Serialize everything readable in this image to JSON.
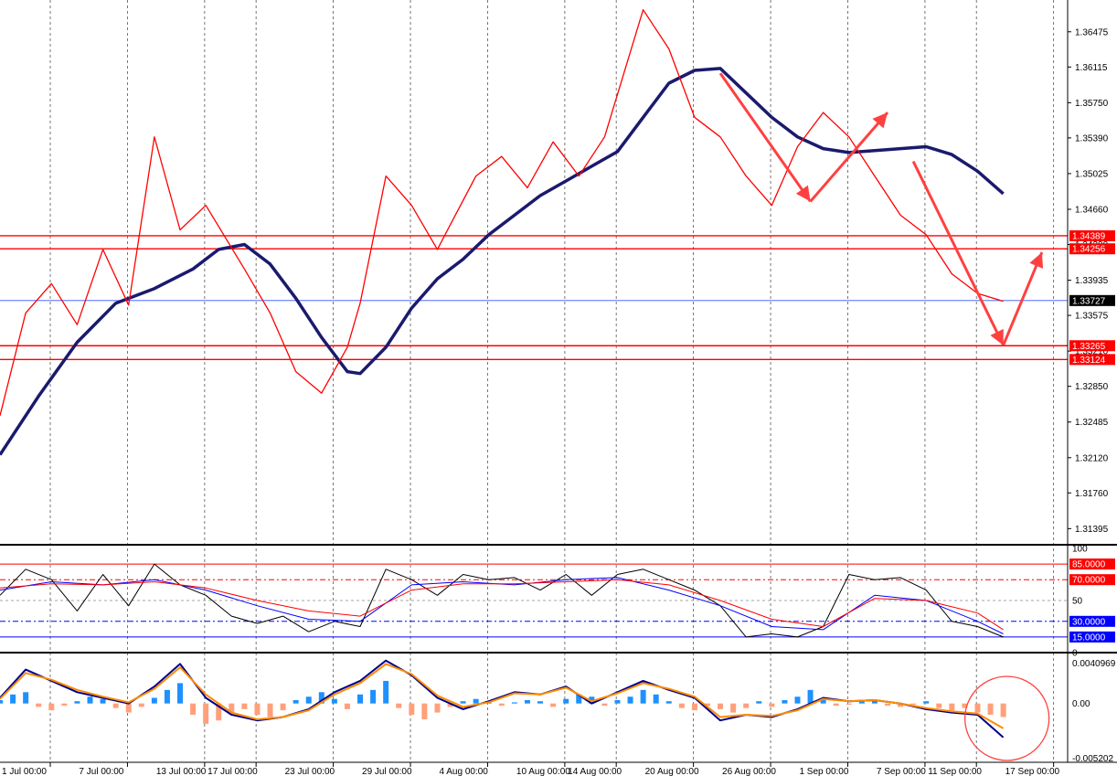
{
  "chart_data": [
    {
      "type": "line",
      "panel": "price",
      "y_axis_ticks": [
        "1.36475",
        "1.36115",
        "1.35750",
        "1.35390",
        "1.35025",
        "1.34660",
        "1.34300",
        "1.33935",
        "1.33575",
        "1.33210",
        "1.32850",
        "1.32485",
        "1.32120",
        "1.31760",
        "1.31395"
      ],
      "y_tick_values": [
        1.36475,
        1.36115,
        1.3575,
        1.3539,
        1.35025,
        1.3466,
        1.343,
        1.33935,
        1.33575,
        1.3321,
        1.3285,
        1.32485,
        1.3212,
        1.3176,
        1.31395
      ],
      "ylim": [
        1.3123,
        1.368
      ],
      "x_axis_ticks": [
        "1 Jul 00:00",
        "7 Jul 00:00",
        "13 Jul 00:00",
        "17 Jul 00:00",
        "23 Jul 00:00",
        "29 Jul 00:00",
        "4 Aug 00:00",
        "10 Aug 00:00",
        "14 Aug 00:00",
        "20 Aug 00:00",
        "26 Aug 00:00",
        "1 Sep 00:00",
        "7 Sep 00:00",
        "11 Sep 00:00",
        "17 Sep 00:00"
      ],
      "x_tick_index": [
        0,
        6,
        12,
        16,
        22,
        28,
        34,
        40,
        44,
        50,
        56,
        62,
        68,
        72,
        78
      ],
      "x_range": [
        0,
        83
      ],
      "horizontal_levels": [
        {
          "label": "1.34389",
          "value": 1.34389,
          "color": "#ff0000"
        },
        {
          "label": "1.34256",
          "value": 1.34256,
          "color": "#ff0000"
        },
        {
          "label": "1.33727",
          "value": 1.33727,
          "color": "#000000"
        },
        {
          "label": "1.33265",
          "value": 1.33265,
          "color": "#ff0000"
        },
        {
          "label": "1.33124",
          "value": 1.33124,
          "color": "#ff0000"
        }
      ],
      "series": [
        {
          "color": "#1a1a6e",
          "x": [
            0,
            3,
            6,
            9,
            12,
            15,
            17,
            19,
            21,
            23,
            25,
            27,
            28,
            30,
            32,
            34,
            36,
            38,
            40,
            42,
            44,
            46,
            48,
            50,
            52,
            54,
            56,
            58,
            60,
            62,
            64,
            66,
            68,
            70,
            72,
            74,
            76,
            78
          ],
          "y": [
            1.3215,
            1.3275,
            1.333,
            1.337,
            1.3385,
            1.3405,
            1.3425,
            1.343,
            1.341,
            1.3375,
            1.3335,
            1.33,
            1.3298,
            1.3325,
            1.3365,
            1.3395,
            1.3415,
            1.344,
            1.346,
            1.348,
            1.3495,
            1.351,
            1.3525,
            1.356,
            1.3595,
            1.3608,
            1.361,
            1.3585,
            1.356,
            1.354,
            1.3528,
            1.3524,
            1.3526,
            1.3528,
            1.353,
            1.3522,
            1.3505,
            1.3482
          ]
        }
      ],
      "zigzag": {
        "color": "#ff0000",
        "x": [
          0,
          2,
          4,
          6,
          8,
          10,
          12,
          14,
          16,
          19,
          21,
          23,
          25,
          27,
          28,
          30,
          32,
          34,
          35,
          37,
          39,
          41,
          43,
          45,
          47,
          50,
          52,
          54,
          56,
          58,
          60,
          62,
          64,
          66,
          68,
          70,
          72,
          74,
          76,
          78
        ],
        "y": [
          1.3255,
          1.336,
          1.339,
          1.3348,
          1.3425,
          1.3368,
          1.354,
          1.3445,
          1.347,
          1.3405,
          1.336,
          1.33,
          1.3278,
          1.3325,
          1.337,
          1.35,
          1.347,
          1.3425,
          1.345,
          1.35,
          1.352,
          1.3488,
          1.3535,
          1.35,
          1.354,
          1.367,
          1.363,
          1.356,
          1.354,
          1.35,
          1.347,
          1.353,
          1.3565,
          1.354,
          1.35,
          1.346,
          1.344,
          1.34,
          1.338,
          1.3372
        ]
      },
      "arrows": [
        {
          "x": [
            56,
            63
          ],
          "y": [
            1.3605,
            1.3474
          ],
          "color": "#ff4040"
        },
        {
          "x": [
            63,
            69
          ],
          "y": [
            1.3474,
            1.3565
          ],
          "color": "#ff4040"
        },
        {
          "x": [
            71,
            78
          ],
          "y": [
            1.3515,
            1.3327
          ],
          "color": "#ff4040"
        },
        {
          "x": [
            78,
            81
          ],
          "y": [
            1.3327,
            1.3422
          ],
          "color": "#ff4040"
        }
      ]
    },
    {
      "type": "line",
      "panel": "oscillator",
      "y_axis_ticks": [
        "100",
        "50",
        "0"
      ],
      "ylim": [
        0,
        100
      ],
      "levels": [
        {
          "label": "85.0000",
          "value": 85,
          "color": "#ff0000"
        },
        {
          "label": "70.0000",
          "value": 70,
          "color": "#ff0000"
        },
        {
          "label": "30.0000",
          "value": 30,
          "color": "#0000ff"
        },
        {
          "label": "15.0000",
          "value": 15,
          "color": "#0000ff"
        }
      ],
      "series": [
        {
          "color": "#000000",
          "x": [
            0,
            2,
            4,
            6,
            8,
            10,
            12,
            14,
            16,
            18,
            20,
            22,
            24,
            26,
            28,
            30,
            32,
            34,
            36,
            38,
            40,
            42,
            44,
            46,
            48,
            50,
            52,
            54,
            56,
            58,
            60,
            62,
            64,
            66,
            68,
            70,
            72,
            74,
            76,
            78
          ],
          "y": [
            55,
            80,
            70,
            40,
            75,
            45,
            85,
            65,
            55,
            35,
            28,
            35,
            20,
            30,
            25,
            80,
            70,
            55,
            75,
            70,
            72,
            60,
            75,
            55,
            75,
            80,
            70,
            60,
            45,
            15,
            18,
            15,
            25,
            75,
            70,
            72,
            60,
            30,
            25,
            15
          ]
        },
        {
          "color": "#0000ff",
          "x": [
            0,
            4,
            8,
            12,
            16,
            20,
            24,
            28,
            32,
            36,
            40,
            44,
            48,
            52,
            56,
            60,
            64,
            68,
            72,
            76,
            78
          ],
          "y": [
            60,
            68,
            65,
            70,
            60,
            45,
            32,
            30,
            65,
            68,
            65,
            70,
            72,
            60,
            45,
            25,
            22,
            55,
            50,
            30,
            18
          ]
        },
        {
          "color": "#ff0000",
          "x": [
            0,
            4,
            8,
            12,
            16,
            20,
            24,
            28,
            32,
            36,
            40,
            44,
            48,
            52,
            56,
            60,
            64,
            68,
            72,
            76,
            78
          ],
          "y": [
            62,
            66,
            65,
            68,
            62,
            50,
            40,
            35,
            60,
            66,
            66,
            68,
            70,
            65,
            50,
            32,
            25,
            52,
            50,
            38,
            22
          ]
        }
      ]
    },
    {
      "type": "line",
      "panel": "macd",
      "y_axis_ticks": [
        "0.0040969",
        "0.00",
        "-0.005202"
      ],
      "ylim": [
        -0.005202,
        0.0040969
      ],
      "series": [
        {
          "color": "#00008b",
          "x": [
            0,
            2,
            4,
            6,
            8,
            10,
            12,
            14,
            16,
            18,
            20,
            22,
            24,
            26,
            28,
            30,
            32,
            34,
            36,
            38,
            40,
            42,
            44,
            46,
            48,
            50,
            52,
            54,
            56,
            58,
            60,
            62,
            64,
            66,
            68,
            70,
            72,
            74,
            76,
            78
          ],
          "y": [
            0.0005,
            0.003,
            0.002,
            0.001,
            0.0005,
            0.0,
            0.0015,
            0.0035,
            0.0005,
            -0.001,
            -0.0015,
            -0.0012,
            -0.0005,
            0.001,
            0.002,
            0.0038,
            0.0025,
            0.0005,
            -0.0005,
            0.0002,
            0.001,
            0.0008,
            0.0015,
            0.0,
            0.001,
            0.002,
            0.0012,
            0.0005,
            -0.0015,
            -0.001,
            -0.0012,
            -0.0005,
            0.0005,
            0.0002,
            0.0003,
            0.0,
            -0.0005,
            -0.0008,
            -0.001,
            -0.003
          ]
        },
        {
          "color": "#ff8c00",
          "x": [
            0,
            2,
            4,
            6,
            8,
            10,
            12,
            14,
            16,
            18,
            20,
            22,
            24,
            26,
            28,
            30,
            32,
            34,
            36,
            38,
            40,
            42,
            44,
            46,
            48,
            50,
            52,
            54,
            56,
            58,
            60,
            62,
            64,
            66,
            68,
            70,
            72,
            74,
            76,
            78
          ],
          "y": [
            0.0004,
            0.0027,
            0.0021,
            0.0012,
            0.0006,
            0.0001,
            0.0013,
            0.0032,
            0.0008,
            -0.0008,
            -0.0014,
            -0.0012,
            -0.0006,
            0.0008,
            0.0018,
            0.0035,
            0.0026,
            0.0007,
            -0.0003,
            0.0001,
            0.0009,
            0.0008,
            0.0014,
            0.0002,
            0.0009,
            0.0018,
            0.0013,
            0.0006,
            -0.0012,
            -0.001,
            -0.0011,
            -0.0006,
            0.0004,
            0.0002,
            0.0003,
            0.0,
            -0.0004,
            -0.0007,
            -0.0009,
            -0.0022
          ]
        }
      ],
      "histogram": {
        "x": [
          0,
          1,
          2,
          3,
          4,
          5,
          6,
          7,
          8,
          9,
          10,
          11,
          12,
          13,
          14,
          15,
          16,
          17,
          18,
          19,
          20,
          21,
          22,
          23,
          24,
          25,
          26,
          27,
          28,
          29,
          30,
          31,
          32,
          33,
          34,
          35,
          36,
          37,
          38,
          39,
          40,
          41,
          42,
          43,
          44,
          45,
          46,
          47,
          48,
          49,
          50,
          51,
          52,
          53,
          54,
          55,
          56,
          57,
          58,
          59,
          60,
          61,
          62,
          63,
          64,
          65,
          66,
          67,
          68,
          69,
          70,
          71,
          72,
          73,
          74,
          75,
          76,
          77,
          78
        ],
        "y": [
          0.0003,
          0.0008,
          0.001,
          -0.0003,
          -0.0006,
          -0.0002,
          0.0002,
          0.0006,
          0.0004,
          -0.0004,
          -0.0008,
          -0.0003,
          0.0005,
          0.0012,
          0.0018,
          -0.001,
          -0.0018,
          -0.0015,
          -0.0008,
          -0.0005,
          -0.001,
          -0.0012,
          -0.0006,
          0.0003,
          0.0006,
          0.001,
          0.0004,
          -0.0005,
          0.0008,
          0.0012,
          0.002,
          -0.0004,
          -0.001,
          -0.0014,
          -0.0008,
          -0.0003,
          0.0002,
          0.0004,
          0.0002,
          -0.0002,
          0.0001,
          0.0003,
          0.0002,
          -0.0003,
          0.0004,
          0.0008,
          0.0006,
          -0.0002,
          0.0003,
          0.0006,
          0.0012,
          0.0008,
          0.0002,
          -0.0004,
          -0.0006,
          -0.0002,
          -0.0005,
          -0.0008,
          -0.0004,
          0.0002,
          -0.0003,
          0.0003,
          0.0006,
          0.0012,
          0.0004,
          -0.0002,
          -0.0001,
          0.0002,
          0.0003,
          -0.0002,
          -0.0003,
          -0.0001,
          0.0002,
          -0.0004,
          -0.0006,
          -0.0004,
          -0.0008,
          -0.001,
          -0.0012
        ],
        "pos_color": "#1e90ff",
        "neg_color": "#ffa07a"
      }
    }
  ],
  "annotations": {
    "circle_color": "#ff4040"
  }
}
